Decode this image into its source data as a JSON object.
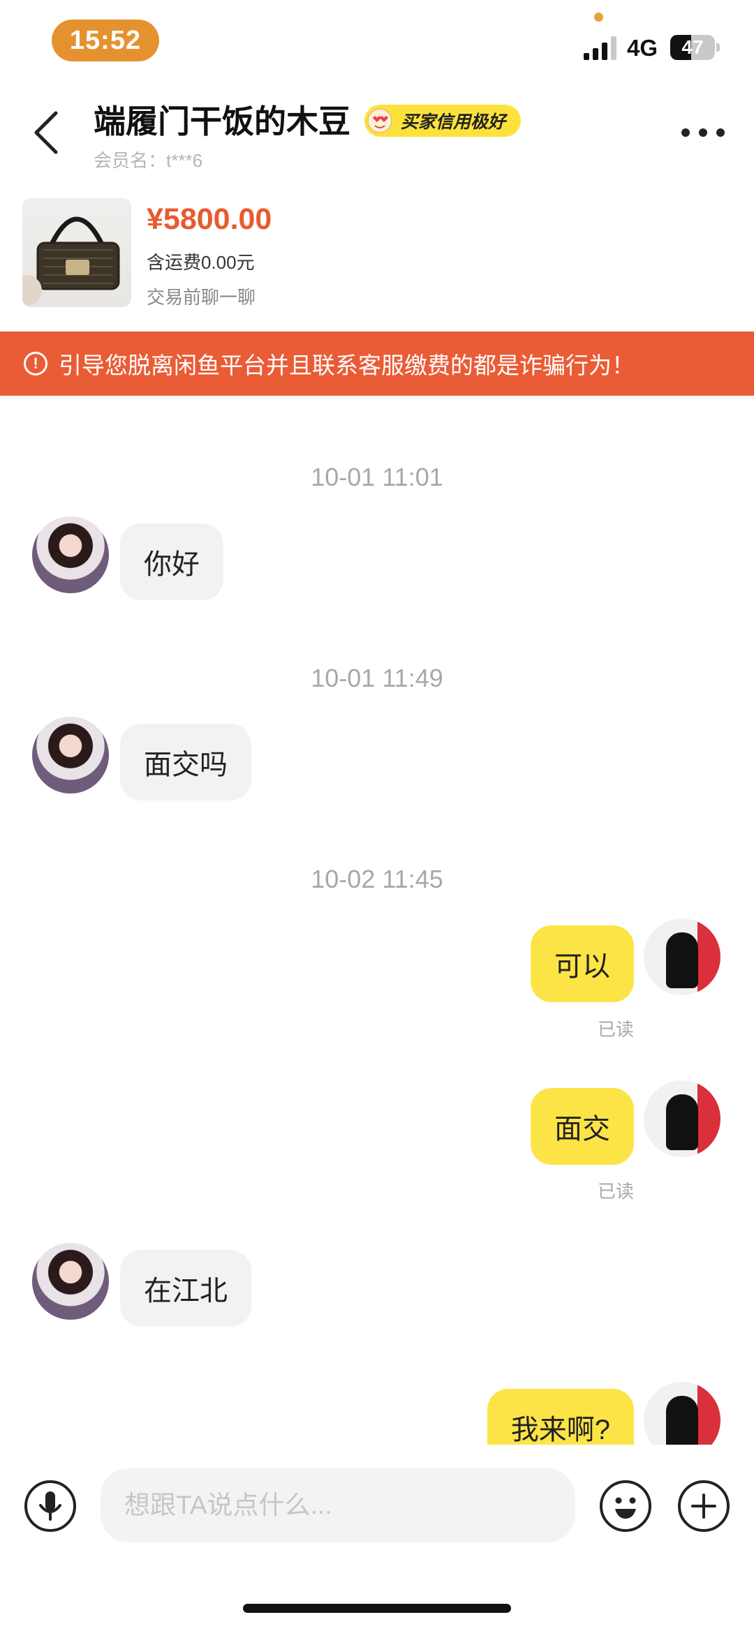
{
  "status_bar": {
    "time": "15:52",
    "network": "4G",
    "battery": "47",
    "battery_level": 0.47
  },
  "header": {
    "title": "端履门干饭的木豆",
    "credit_badge": "买家信用极好",
    "member_label": "会员名：t***6",
    "back_icon": "chevron-left-icon",
    "more_icon": "more-dots-icon"
  },
  "product": {
    "price": "¥5800.00",
    "shipping": "含运费0.00元",
    "chat_first": "交易前聊一聊"
  },
  "warning": {
    "text": "引导您脱离闲鱼平台并且联系客服缴费的都是诈骗行为！",
    "icon": "alert-circle-icon"
  },
  "messages": [
    {
      "timestamp": "10-01 11:01",
      "side": "in",
      "text": "你好"
    },
    {
      "timestamp": "10-01 11:49",
      "side": "in",
      "text": "面交吗"
    },
    {
      "timestamp": "10-02 11:45",
      "side": "out",
      "text": "可以",
      "read": "已读"
    },
    {
      "side": "out",
      "text": "面交",
      "read": "已读"
    },
    {
      "side": "in",
      "text": "在江北"
    },
    {
      "side": "out",
      "text": "我来啊?"
    }
  ],
  "input": {
    "placeholder": "想跟TA说点什么...",
    "mic_icon": "microphone-icon",
    "emoji_icon": "emoji-icon",
    "plus_icon": "plus-icon"
  },
  "colors": {
    "accent_orange": "#ea5c36",
    "price": "#e85a2e",
    "bubble_out": "#fde446",
    "badge": "#fde23b",
    "time_pill": "#e6912f"
  }
}
